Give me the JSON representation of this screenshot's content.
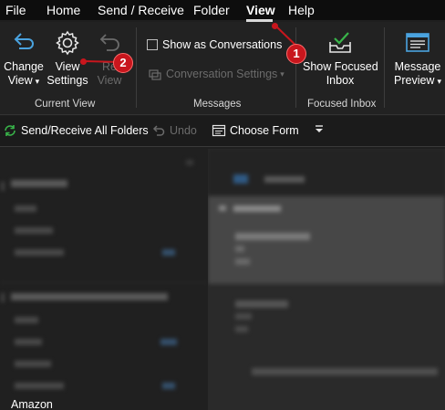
{
  "tabs": [
    {
      "label": "File"
    },
    {
      "label": "Home"
    },
    {
      "label": "Send / Receive"
    },
    {
      "label": "Folder"
    },
    {
      "label": "View"
    },
    {
      "label": "Help"
    }
  ],
  "ribbon": {
    "change_view": {
      "line1": "Change",
      "line2": "View",
      "icon": "change-view-icon"
    },
    "view_settings": {
      "line1": "View",
      "line2": "Settings",
      "icon": "gear-icon"
    },
    "reset_view": {
      "line1": "Re",
      "line2": "View",
      "icon": "reset-view-icon"
    },
    "current_view_label": "Current View",
    "show_conversations": {
      "label": "Show as Conversations",
      "checked": false
    },
    "conversation_settings": {
      "label": "Conversation Settings"
    },
    "messages_label": "Messages",
    "show_focused_inbox": {
      "line1": "Show Focused",
      "line2": "Inbox",
      "icon": "focused-inbox-icon"
    },
    "focused_inbox_label": "Focused Inbox",
    "message_preview": {
      "line1": "Message",
      "line2": "Preview",
      "icon": "message-preview-icon"
    }
  },
  "quickbar": {
    "send_receive": "Send/Receive All Folders",
    "undo": "Undo",
    "choose_form": "Choose Form"
  },
  "folders": {
    "bottom_item": "Amazon"
  },
  "markers": [
    {
      "number": "1"
    },
    {
      "number": "2"
    }
  ],
  "colors": {
    "marker": "#c8161d",
    "background": "#1f1f1f",
    "ribbon": "#222222",
    "accent_blue": "#4aa3df"
  }
}
